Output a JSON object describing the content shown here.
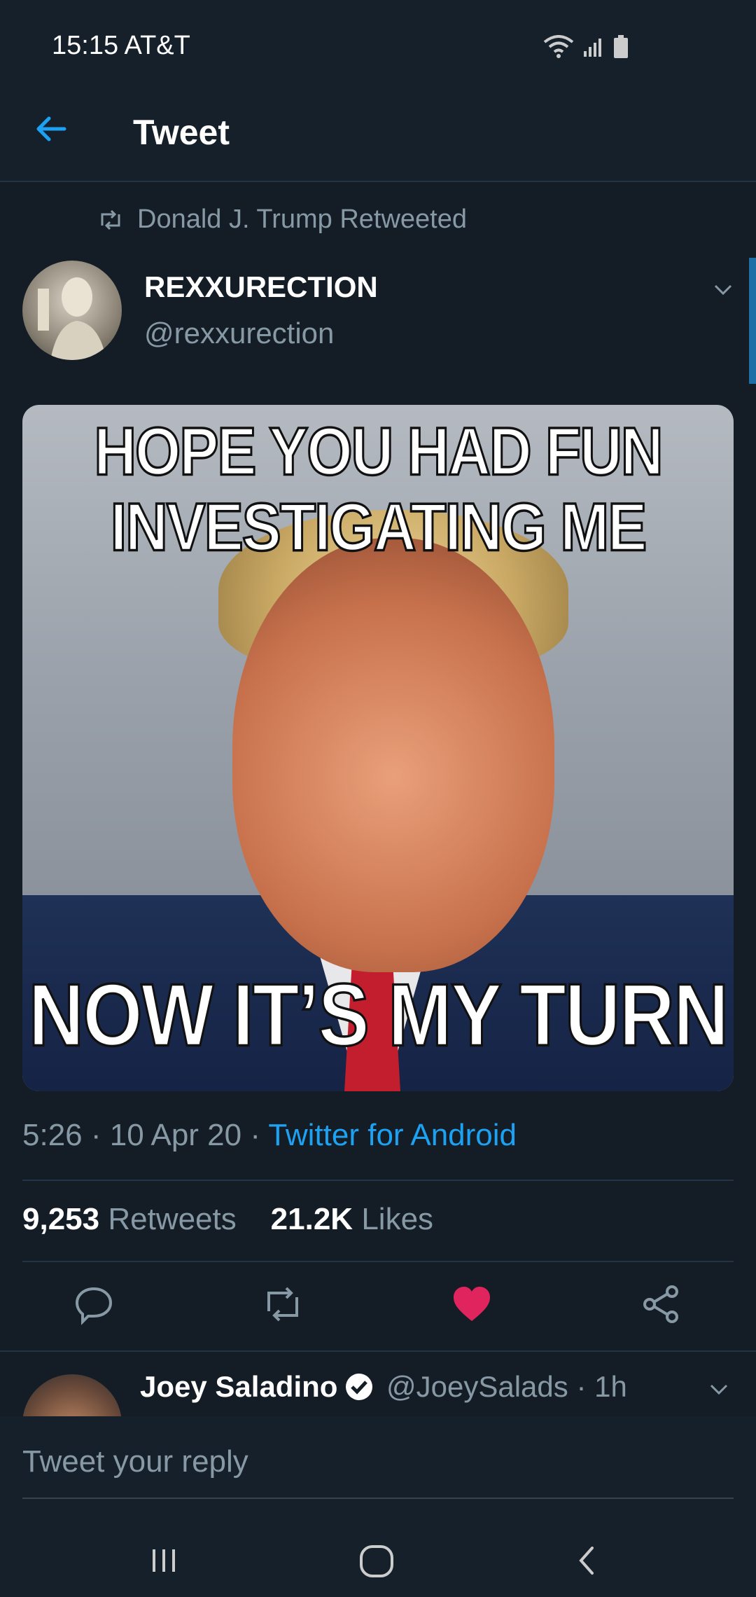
{
  "status_bar": {
    "time": "15:15 AT&T"
  },
  "header": {
    "title": "Tweet"
  },
  "retweet": {
    "text": "Donald J. Trump Retweeted"
  },
  "tweet": {
    "author_name": "REXXURECTION",
    "author_handle": "@rexxurection",
    "image_text_top_line1": "HOPE YOU HAD FUN",
    "image_text_top_line2": "INVESTIGATING ME",
    "image_text_bottom": "NOW IT’S MY TURN",
    "meta_time": "5:26 · 10 Apr 20 · ",
    "meta_source": "Twitter for Android",
    "retweets_count": "9,253",
    "retweets_label": "Retweets",
    "likes_count": "21.2K",
    "likes_label": "Likes"
  },
  "reply": {
    "name": "Joey Saladino",
    "handle": "@JoeySalads · 1h"
  },
  "composer": {
    "placeholder": "Tweet your reply"
  },
  "colors": {
    "accent": "#1da1f2",
    "like": "#e0245e",
    "background": "#141d26",
    "muted": "#8899a6"
  },
  "icons": [
    "wifi-icon",
    "signal-icon",
    "battery-icon",
    "back-arrow-icon",
    "retweet-icon",
    "chevron-down-icon",
    "reply-icon",
    "retweet-icon",
    "heart-icon",
    "share-icon",
    "verified-badge-icon",
    "recents-icon",
    "home-icon",
    "back-icon"
  ]
}
